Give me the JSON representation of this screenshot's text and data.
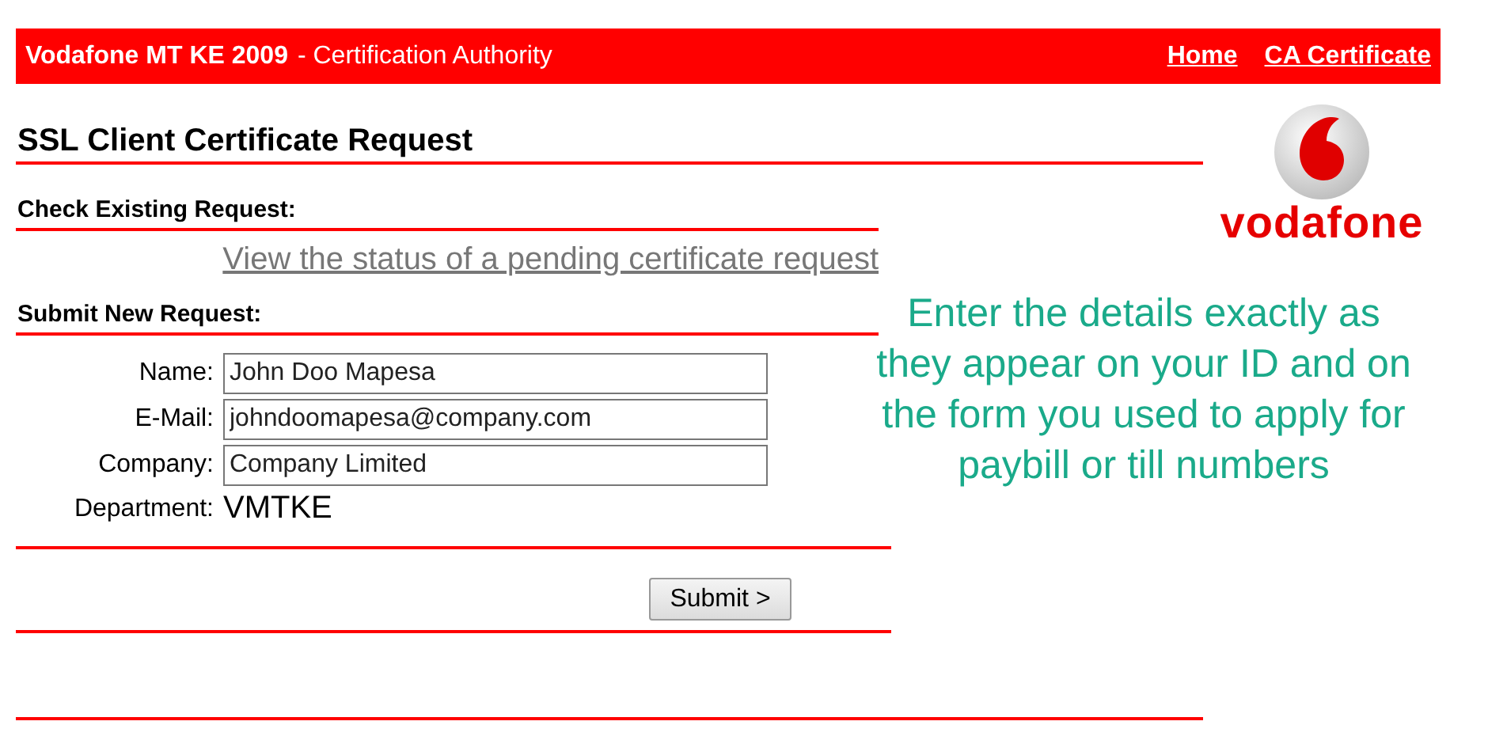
{
  "header": {
    "brand": "Vodafone MT KE 2009",
    "subtitle": "-  Certification Authority",
    "links": [
      "Home",
      "CA Certificate"
    ]
  },
  "logo": {
    "wordmark": "vodafone"
  },
  "title": "SSL Client Certificate Request",
  "check_existing": {
    "heading": "Check Existing Request:",
    "link": "View the status of a pending certificate request"
  },
  "submit_new": {
    "heading": "Submit New Request:",
    "fields": [
      {
        "kind": "input",
        "label": "Name:",
        "value": "John Doo Mapesa"
      },
      {
        "kind": "input",
        "label": "E-Mail:",
        "value": "johndoomapesa@company.com"
      },
      {
        "kind": "input",
        "label": "Company:",
        "value": "Company Limited"
      },
      {
        "kind": "static",
        "label": "Department:",
        "value": "VMTKE"
      }
    ],
    "button": "Submit >"
  },
  "note": {
    "lines": [
      "Enter the details exactly as",
      "they appear on your ID and on",
      "the form you used to apply for",
      "paybill or till  numbers"
    ]
  }
}
